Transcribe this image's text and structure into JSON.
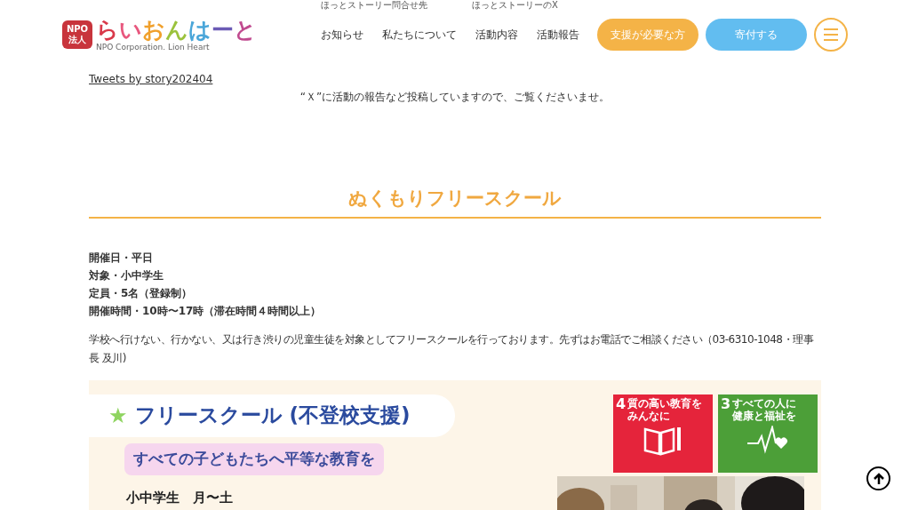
{
  "header": {
    "logo": {
      "badge": [
        "NPO",
        "法人"
      ],
      "letters": [
        {
          "char": "ら",
          "color": "#d9394a"
        },
        {
          "char": "い",
          "color": "#e8577e"
        },
        {
          "char": "お",
          "color": "#f0a02c"
        },
        {
          "char": "ん",
          "color": "#9bc23c"
        },
        {
          "char": "は",
          "color": "#4aa6d9"
        },
        {
          "char": "ー",
          "color": "#6b5bb5"
        },
        {
          "char": "と",
          "color": "#c04a8f"
        }
      ],
      "subtitle": "NPO Corporation. Lion Heart"
    },
    "top_links": [
      "ほっとストーリー問合せ先",
      "ほっとストーリーのX"
    ],
    "nav": [
      "お知らせ",
      "私たちについて",
      "活動内容",
      "活動報告"
    ],
    "buttons": [
      {
        "label": "支援が必要な方",
        "kind": "support"
      },
      {
        "label": "寄付する",
        "kind": "donate"
      }
    ]
  },
  "tweets_link": "Tweets by story202404",
  "notice": "“Ｘ”に活動の報告など投稿していますので、ご覧くださいませ。",
  "section": {
    "title": "ぬくもりフリースクール",
    "details": [
      "開催日・平日",
      "対象・小中学生",
      "定員・5名（登録制）",
      "開催時間・10時〜17時（滞在時間４時間以上）"
    ],
    "description": "学校へ行けない、行かない、又は行き渋りの児童生徒を対象としてフリースクールを行っております。先ずはお電話でご相談ください（03-6310-1048・理事長 及川)",
    "flyer": {
      "star": "★",
      "title": "フリースクール (不登校支援)",
      "tagline": "すべての子どもたちへ平等な教育を",
      "schedule": "小中学生　月〜土",
      "goals": [
        {
          "number": "4",
          "text": [
            "質の高い教育を",
            "みんなに"
          ],
          "color": "#e5243b",
          "kind": "book"
        },
        {
          "number": "3",
          "text": [
            "すべての人に",
            "健康と福祉を"
          ],
          "color": "#4c9f38",
          "kind": "health"
        }
      ]
    }
  }
}
